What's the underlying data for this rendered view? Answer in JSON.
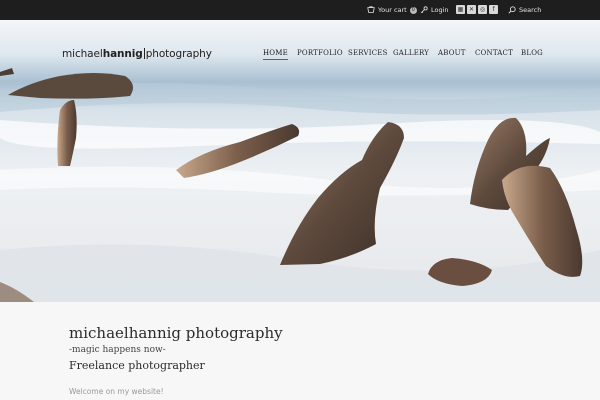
{
  "topbar": {
    "cart_label": "Your cart",
    "cart_count": "0",
    "login_label": "Login",
    "social_icons": [
      "facebook-icon",
      "twitter-icon",
      "instagram-icon",
      "flickr-icon"
    ],
    "search_label": "Search"
  },
  "logo": {
    "part1": "michael",
    "part2": "hannig",
    "part3": "photography"
  },
  "nav": {
    "items": [
      "HOME",
      "PORTFOLIO",
      "SERVICES",
      "GALLERY",
      "ABOUT",
      "CONTACT",
      "BLOG"
    ],
    "active": "HOME",
    "accent_color": "#c0392b"
  },
  "content": {
    "site_title": "michaelhannig photography",
    "tagline": "-magic happens now-",
    "subtitle": "Freelance photographer",
    "welcome": "Welcome on my website!"
  }
}
